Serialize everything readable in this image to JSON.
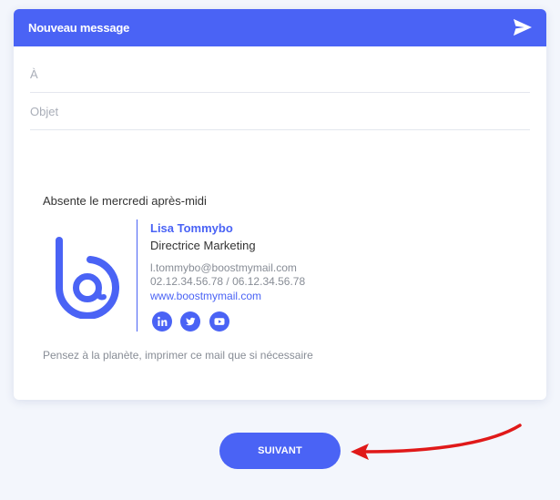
{
  "compose": {
    "title": "Nouveau message",
    "to_placeholder": "À",
    "subject_placeholder": "Objet"
  },
  "signature": {
    "absence_note": "Absente le mercredi après-midi",
    "name": "Lisa Tommybo",
    "role": "Directrice Marketing",
    "email": "l.tommybo@boostmymail.com",
    "phone": "02.12.34.56.78 / 06.12.34.56.78",
    "website": "www.boostmymail.com",
    "footer": "Pensez à la planète, imprimer ce mail que si nécessaire"
  },
  "actions": {
    "next_label": "SUIVANT"
  },
  "colors": {
    "accent": "#4a63f5",
    "arrow": "#e01919",
    "background": "#f3f6fc"
  },
  "icons": {
    "send": "send-icon",
    "logo": "boostmymail-logo",
    "social": [
      "linkedin-icon",
      "twitter-icon",
      "youtube-icon"
    ]
  }
}
